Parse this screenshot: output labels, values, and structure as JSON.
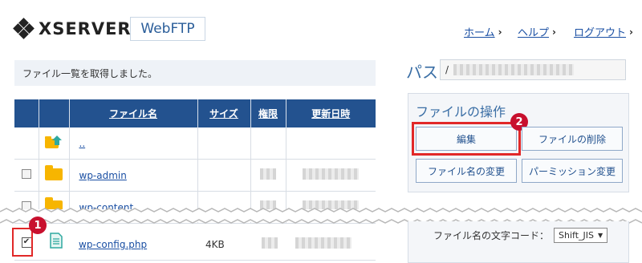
{
  "header": {
    "brand": "XSERVER",
    "product": "WebFTP",
    "nav": [
      {
        "label": "ホーム"
      },
      {
        "label": "ヘルプ"
      },
      {
        "label": "ログアウト"
      }
    ]
  },
  "status_message": "ファイル一覧を取得しました。",
  "table": {
    "columns": [
      "ファイル名",
      "サイズ",
      "権限",
      "更新日時"
    ],
    "rows": [
      {
        "name": "..",
        "type": "parent",
        "size": ""
      },
      {
        "name": "wp-admin",
        "type": "folder",
        "size": ""
      },
      {
        "name": "wp-content",
        "type": "folder",
        "size": ""
      },
      {
        "name": "wp-config.php",
        "type": "file",
        "size": "4KB",
        "checked": true
      }
    ]
  },
  "path": {
    "label": "パス",
    "value": "/"
  },
  "file_ops": {
    "title": "ファイルの操作",
    "edit": "編集",
    "delete": "ファイルの削除",
    "rename": "ファイル名の変更",
    "permission": "パーミッション変更"
  },
  "encoding": {
    "label": "ファイル名の文字コード：",
    "value": "Shift_JIS"
  },
  "markers": {
    "one": "1",
    "two": "2"
  },
  "colors": {
    "header_blue": "#23528f",
    "accent_red": "#c8102e",
    "folder": "#f7b500"
  }
}
